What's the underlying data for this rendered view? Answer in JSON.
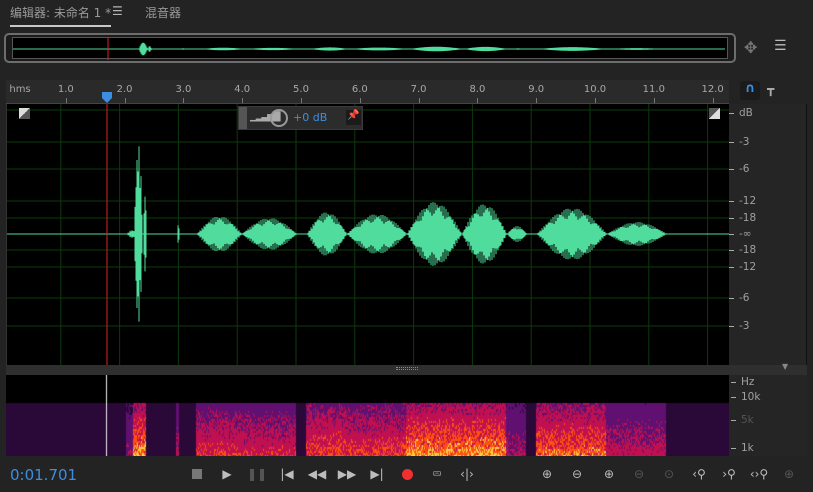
{
  "tabs": {
    "editor": "编辑器: 未命名 1 *",
    "mixer": "混音器",
    "menu_icon": "hamburger-icon"
  },
  "ruler": {
    "unit": "hms",
    "ticks": [
      "1.0",
      "2.0",
      "3.0",
      "4.0",
      "5.0",
      "6.0",
      "7.0",
      "8.0",
      "9.0",
      "10.0",
      "11.0",
      "12.0"
    ]
  },
  "hud": {
    "gain": "+0 dB"
  },
  "db_scale": {
    "unit": "dB",
    "labels": [
      "-3",
      "-6",
      "-12",
      "-18",
      "-∞",
      "-18",
      "-12",
      "-6",
      "-3"
    ]
  },
  "hz_scale": {
    "unit": "Hz",
    "labels": [
      "10k",
      "5k",
      "1k"
    ]
  },
  "transport": {
    "time": "0:01.701"
  },
  "playhead_seconds": 1.701,
  "colors": {
    "waveform": "#4fdc9c",
    "playhead": "#e02020",
    "accent": "#3d8ee0"
  }
}
